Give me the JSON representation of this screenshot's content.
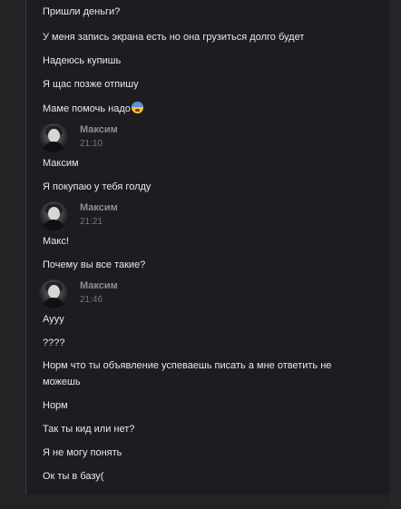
{
  "messages": {
    "m1": "Пришли деньги?",
    "m2": "У меня запись экрана есть но она грузиться долго будет",
    "m3": "Надеюсь купишь",
    "m4": "Я щас позже отпишу",
    "m5": "Маме помочь надо",
    "m6": "Максим",
    "m7": "Я покупаю у тебя голду",
    "m8": "Макс!",
    "m9": "Почему вы все такие?",
    "m10": "Аууу",
    "m11": "????",
    "m12": "Норм что ты объявление успеваешь писать а мне ответить не можешь",
    "m13": "Норм",
    "m14": "Так ты кид или нет?",
    "m15": "Я не могу понять",
    "m16": "Ок ты в базу("
  },
  "groups": [
    {
      "author": "Максим",
      "time": "21:10"
    },
    {
      "author": "Максим",
      "time": "21:21"
    },
    {
      "author": "Максим",
      "time": "21:46"
    }
  ],
  "emoji": {
    "fearful": "fearful-face-icon"
  }
}
